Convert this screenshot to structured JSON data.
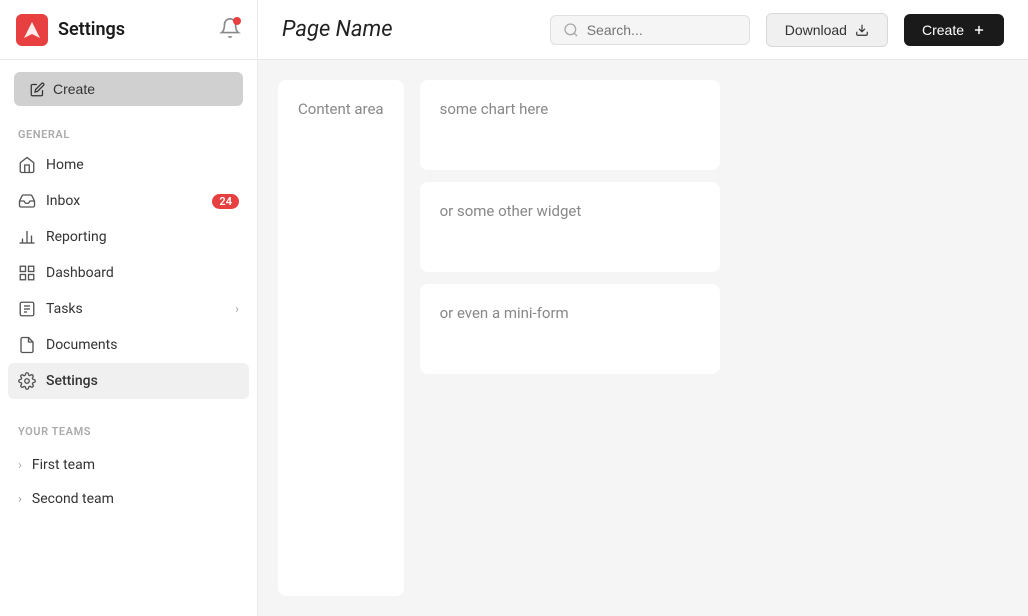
{
  "sidebar": {
    "title": "Settings",
    "create_label": "Create",
    "general_label": "GENERAL",
    "your_teams_label": "YOUR TEAMS",
    "nav_items": [
      {
        "id": "home",
        "label": "Home",
        "icon": "home"
      },
      {
        "id": "inbox",
        "label": "Inbox",
        "icon": "inbox",
        "badge": "24"
      },
      {
        "id": "reporting",
        "label": "Reporting",
        "icon": "reporting"
      },
      {
        "id": "dashboard",
        "label": "Dashboard",
        "icon": "dashboard"
      },
      {
        "id": "tasks",
        "label": "Tasks",
        "icon": "tasks",
        "chevron": true
      },
      {
        "id": "documents",
        "label": "Documents",
        "icon": "documents"
      },
      {
        "id": "settings",
        "label": "Settings",
        "icon": "settings",
        "active": true
      }
    ],
    "teams": [
      {
        "id": "first-team",
        "label": "First team"
      },
      {
        "id": "second-team",
        "label": "Second team"
      }
    ]
  },
  "topbar": {
    "page_title": "Page Name",
    "search_placeholder": "Search...",
    "download_label": "Download",
    "create_label": "Create"
  },
  "main": {
    "content_area_label": "Content area",
    "widgets": [
      {
        "id": "chart",
        "label": "some chart here"
      },
      {
        "id": "widget",
        "label": "or some other widget"
      },
      {
        "id": "mini-form",
        "label": "or even a mini-form"
      }
    ]
  }
}
